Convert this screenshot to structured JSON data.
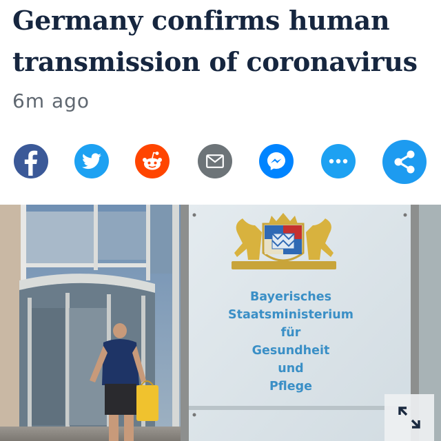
{
  "article": {
    "headline_line1": "Germany confirms human",
    "headline_line2": "transmission of coronavirus",
    "timestamp": "6m ago"
  },
  "share": {
    "buttons": [
      {
        "name": "facebook",
        "icon": "facebook-icon",
        "color": "#3b5998"
      },
      {
        "name": "twitter",
        "icon": "twitter-icon",
        "color": "#1da1f2"
      },
      {
        "name": "reddit",
        "icon": "reddit-icon",
        "color": "#ff4500"
      },
      {
        "name": "email",
        "icon": "mail-icon",
        "color": "#6d7478"
      },
      {
        "name": "messenger",
        "icon": "messenger-icon",
        "color": "#0084ff"
      },
      {
        "name": "more",
        "icon": "more-dots-icon",
        "color": "#1da1f2"
      },
      {
        "name": "share",
        "icon": "share-icon",
        "color": "#1d9bf0"
      }
    ]
  },
  "photo": {
    "sign_lines": [
      "Bayerisches",
      "Staatsministerium",
      "für",
      "Gesundheit",
      "und",
      "Pflege"
    ],
    "sign_text_color": "#3a8fc6"
  },
  "controls": {
    "expand_icon": "expand-arrows-icon"
  }
}
